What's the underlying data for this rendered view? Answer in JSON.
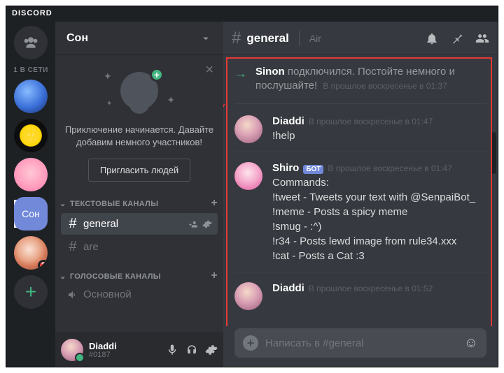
{
  "brand": "DISCORD",
  "guilds": {
    "online_label": "1 В СЕТИ",
    "selected_label": "Сон",
    "badge_count": "2",
    "add_label": "+"
  },
  "server": {
    "name": "Сон"
  },
  "invite": {
    "text": "Приключение начинается. Давайте добавим немного участников!",
    "button": "Пригласить людей"
  },
  "categories": {
    "text": {
      "label": "ТЕКСТОВЫЕ КАНАЛЫ"
    },
    "voice": {
      "label": "ГОЛОСОВЫЕ КАНАЛЫ"
    }
  },
  "channels": {
    "text": [
      {
        "name": "general"
      },
      {
        "name": "are"
      }
    ],
    "voice": [
      {
        "name": "Основной"
      }
    ]
  },
  "user": {
    "name": "Diaddi",
    "tag": "#0187"
  },
  "chat": {
    "channel": "general",
    "topic": "Air",
    "input_placeholder": "Написать в #general"
  },
  "messages": {
    "system": {
      "prefix": "Sinon",
      "text": " подключился. Постойте немного и послушайте!",
      "time": "В прошлое воскресенье в 01:37"
    },
    "list": [
      {
        "author": "Diaddi",
        "bot": false,
        "avatar": "d",
        "time": "В прошлое воскресенье в 01:47",
        "body": "!help"
      },
      {
        "author": "Shiro",
        "bot": true,
        "avatar": "s",
        "time": "В прошлое воскресенье в 01:47",
        "body": "Commands:\n!tweet - Tweets your text with @SenpaiBot_\n!meme - Posts a spicy meme\n!smug - :^)\n!r34 - Posts lewd image from rule34.xxx\n!cat - Posts a Cat :3"
      },
      {
        "author": "Diaddi",
        "bot": false,
        "avatar": "d",
        "time": "В прошлое воскресенье в 01:52",
        "body": ""
      }
    ],
    "bot_tag": "БОТ"
  }
}
